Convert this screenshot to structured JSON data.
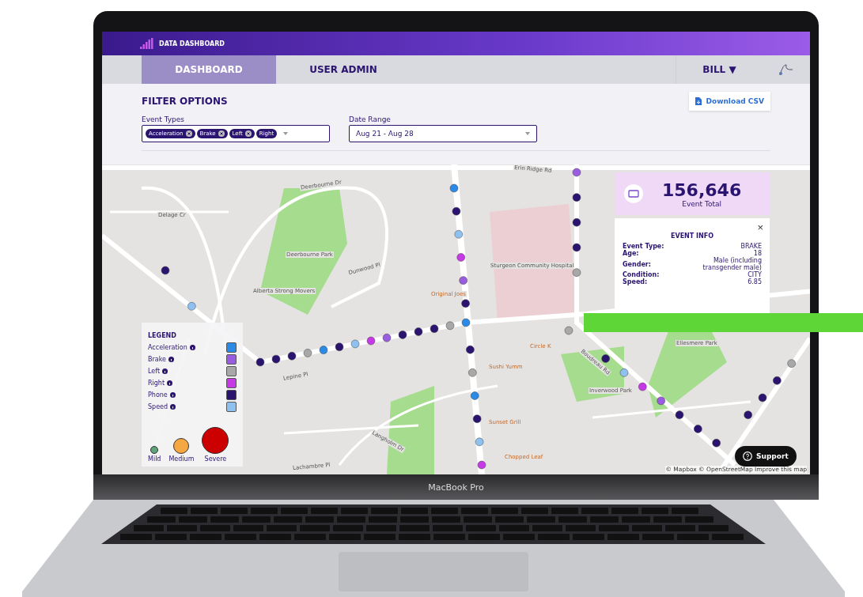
{
  "app": {
    "brand": "DATA DASHBOARD"
  },
  "nav": {
    "tabs": [
      {
        "label": "DASHBOARD",
        "selected": true
      },
      {
        "label": "USER ADMIN",
        "selected": false
      }
    ],
    "user": "BILL",
    "user_caret": "▼"
  },
  "filters": {
    "title": "FILTER OPTIONS",
    "download": "Download CSV",
    "event_types": {
      "label": "Event Types",
      "chips": [
        {
          "label": "Acceleration",
          "removable": true
        },
        {
          "label": "Brake",
          "removable": true
        },
        {
          "label": "Left",
          "removable": true
        },
        {
          "label": "Right",
          "removable": false
        }
      ]
    },
    "date_range": {
      "label": "Date Range",
      "value": "Aug 21 - Aug 28"
    }
  },
  "map": {
    "labels": [
      "Delage Cr",
      "Deerbourne Dr",
      "Deerbourne Park",
      "Dunwood Pl",
      "Alberta Strong Movers",
      "Sturgeon Community Hospital",
      "Erin Ridge Rd",
      "Circle K",
      "Sushi Yumm",
      "Sunset Grill",
      "Lepine Pl",
      "Langholm Dr",
      "Lachambre Pl",
      "Inverwood Park",
      "Ellesmere Park",
      "Boudreau Rd",
      "Chopped Leaf",
      "Original Joes"
    ],
    "attribution": "© Mapbox © OpenStreetMap Improve this map",
    "total": {
      "value": "156,646",
      "label": "Event Total"
    },
    "event_info": {
      "title": "EVENT INFO",
      "close": "×",
      "rows": [
        {
          "label": "Event Type:",
          "value": "BRAKE"
        },
        {
          "label": "Age:",
          "value": "18"
        },
        {
          "label": "Gender:",
          "value": "Male (including transgender male)"
        },
        {
          "label": "Condition:",
          "value": "CITY"
        },
        {
          "label": "Speed:",
          "value": "6.85"
        }
      ]
    },
    "legend": {
      "title": "LEGEND",
      "types": [
        {
          "name": "Acceleration",
          "color": "#2b8ae6"
        },
        {
          "name": "Brake",
          "color": "#9a5ce0"
        },
        {
          "name": "Left",
          "color": "#a8a8a8"
        },
        {
          "name": "Right",
          "color": "#c63ae6"
        },
        {
          "name": "Phone",
          "color": "#2a1470"
        },
        {
          "name": "Speed",
          "color": "#8ec0f0"
        }
      ],
      "sizes": [
        {
          "name": "Mild",
          "color": "#5fa37a"
        },
        {
          "name": "Medium",
          "color": "#f5a742"
        },
        {
          "name": "Severe",
          "color": "#cc0000"
        }
      ]
    },
    "support": "Support"
  },
  "laptop": {
    "model": "MacBook Pro"
  }
}
